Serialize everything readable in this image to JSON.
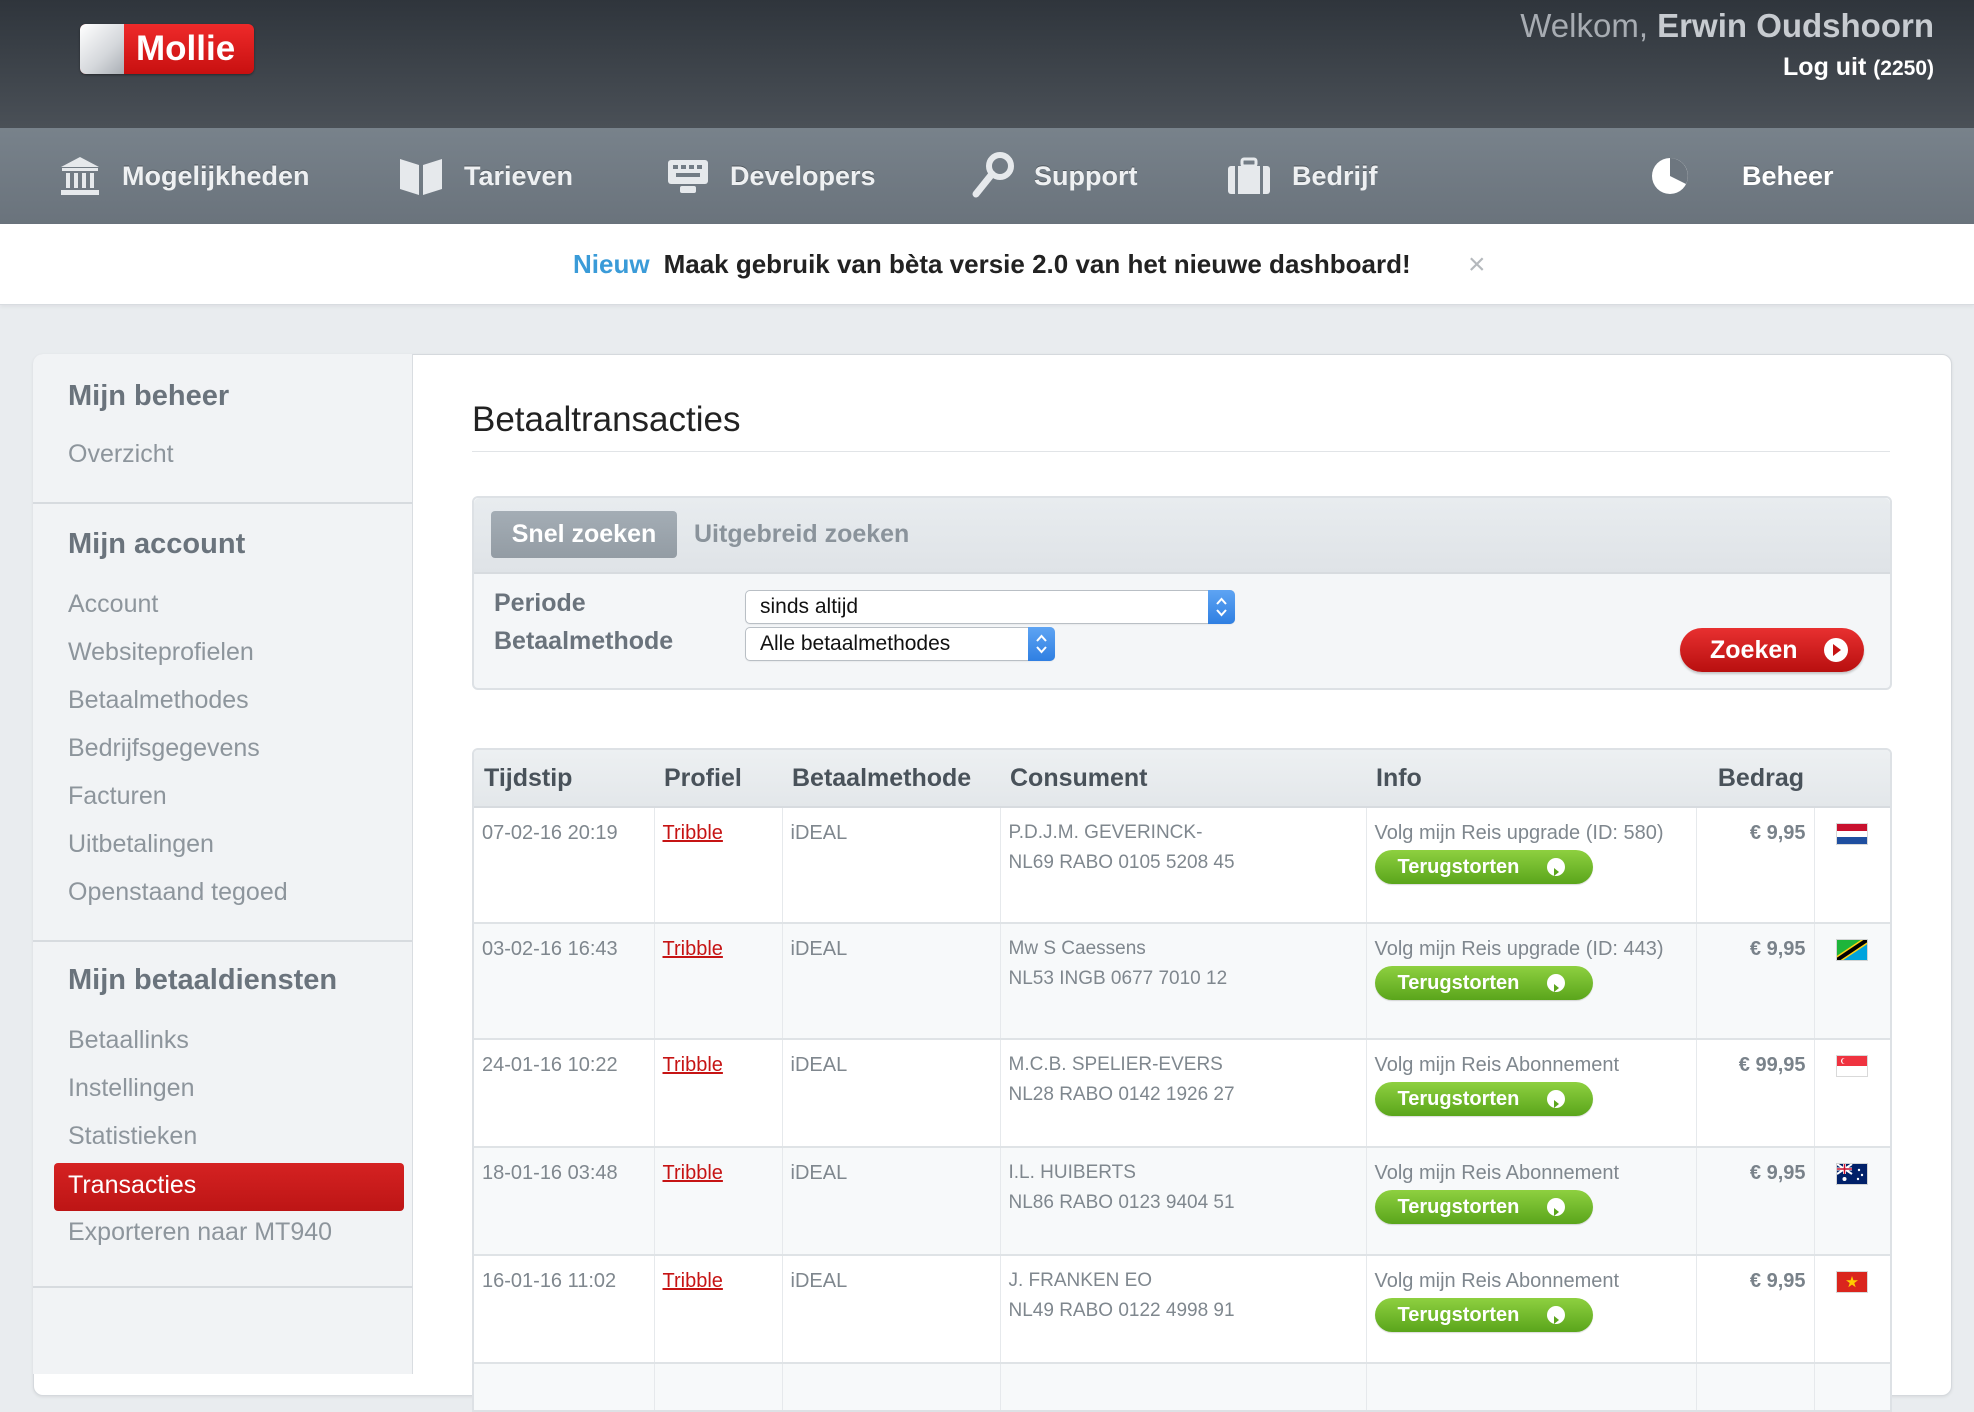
{
  "header": {
    "logo_text": "Mollie",
    "welcome_prefix": "Welkom,",
    "user_name": "Erwin Oudshoorn",
    "logout_label": "Log uit",
    "logout_count": "(2250)"
  },
  "nav": {
    "items": [
      {
        "label": "Mogelijkheden",
        "icon": "bank-icon"
      },
      {
        "label": "Tarieven",
        "icon": "book-icon"
      },
      {
        "label": "Developers",
        "icon": "keyboard-icon"
      },
      {
        "label": "Support",
        "icon": "wrench-icon"
      },
      {
        "label": "Bedrijf",
        "icon": "briefcase-icon"
      },
      {
        "label": "Beheer",
        "icon": "pie-chart-icon"
      }
    ]
  },
  "notice": {
    "badge": "Nieuw",
    "message": "Maak gebruik van bèta versie 2.0 van het nieuwe dashboard!",
    "close": "×"
  },
  "sidebar": {
    "sections": [
      {
        "title": "Mijn beheer",
        "links": [
          "Overzicht"
        ]
      },
      {
        "title": "Mijn account",
        "links": [
          "Account",
          "Websiteprofielen",
          "Betaalmethodes",
          "Bedrijfsgegevens",
          "Facturen",
          "Uitbetalingen",
          "Openstaand tegoed"
        ]
      },
      {
        "title": "Mijn betaaldiensten",
        "links": [
          "Betaallinks",
          "Instellingen",
          "Statistieken",
          "Transacties",
          "Exporteren naar MT940"
        ],
        "active": "Transacties"
      }
    ]
  },
  "main": {
    "title": "Betaaltransacties",
    "search": {
      "tab_quick": "Snel zoeken",
      "tab_advanced": "Uitgebreid zoeken",
      "period_label": "Periode",
      "period_value": "sinds altijd",
      "method_label": "Betaalmethode",
      "method_value": "Alle betaalmethodes",
      "submit": "Zoeken"
    },
    "table": {
      "headers": [
        "Tijdstip",
        "Profiel",
        "Betaalmethode",
        "Consument",
        "Info",
        "Bedrag"
      ],
      "refund_label": "Terugstorten",
      "rows": [
        {
          "time": "07-02-16 20:19",
          "profile": "Tribble",
          "method": "iDEAL",
          "consumer_name": "P.D.J.M. GEVERINCK-",
          "consumer_iban": "NL69 RABO 0105 5208 45",
          "info": "Volg mijn Reis upgrade (ID: 580)",
          "amount": "€ 9,95",
          "flag": "netherlands-flag"
        },
        {
          "time": "03-02-16 16:43",
          "profile": "Tribble",
          "method": "iDEAL",
          "consumer_name": "Mw S Caessens",
          "consumer_iban": "NL53 INGB 0677 7010 12",
          "info": "Volg mijn Reis upgrade (ID: 443)",
          "amount": "€ 9,95",
          "flag": "tanzania-flag"
        },
        {
          "time": "24-01-16 10:22",
          "profile": "Tribble",
          "method": "iDEAL",
          "consumer_name": "M.C.B. SPELIER-EVERS",
          "consumer_iban": "NL28 RABO 0142 1926 27",
          "info": "Volg mijn Reis Abonnement",
          "amount": "€ 99,95",
          "flag": "singapore-flag"
        },
        {
          "time": "18-01-16 03:48",
          "profile": "Tribble",
          "method": "iDEAL",
          "consumer_name": "I.L. HUIBERTS",
          "consumer_iban": "NL86 RABO 0123 9404 51",
          "info": "Volg mijn Reis Abonnement",
          "amount": "€ 9,95",
          "flag": "australia-flag"
        },
        {
          "time": "16-01-16 11:02",
          "profile": "Tribble",
          "method": "iDEAL",
          "consumer_name": "J. FRANKEN EO",
          "consumer_iban": "NL49 RABO 0122 4998 91",
          "info": "Volg mijn Reis Abonnement",
          "amount": "€ 9,95",
          "flag": "vietnam-flag"
        }
      ]
    }
  },
  "colors": {
    "brand_red": "#c81a1a",
    "notice_blue": "#3a9bd8",
    "refund_green": "#6cb52a",
    "select_blue": "#2f7fe2"
  }
}
